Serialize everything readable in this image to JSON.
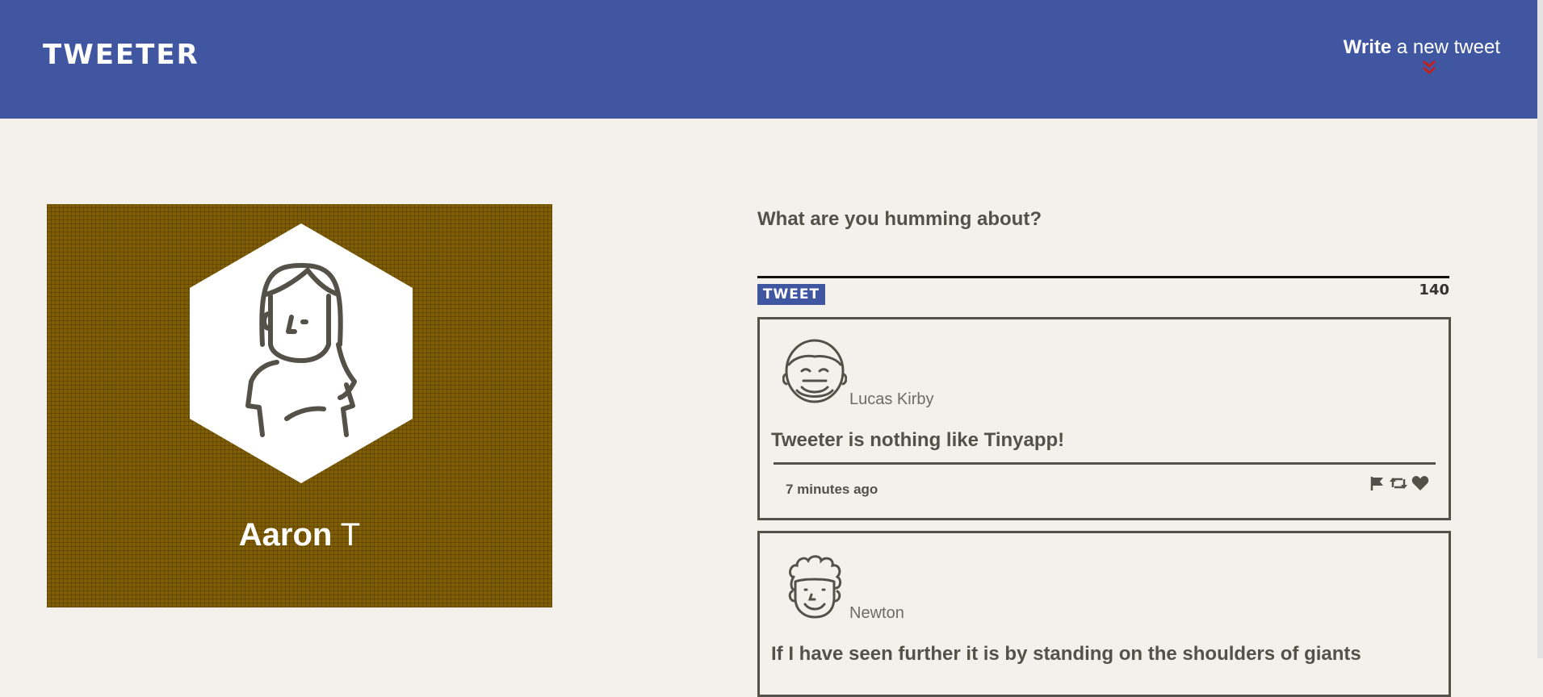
{
  "nav": {
    "brand": "TWEETER",
    "compose_bold": "Write",
    "compose_rest": " a new tweet"
  },
  "profile": {
    "first_name": "Aaron",
    "last_name": "T"
  },
  "composer": {
    "prompt": "What are you humming about?",
    "submit_label": "TWEET",
    "counter": "140"
  },
  "tweets": [
    {
      "handle": "Lucas Kirby",
      "content": "Tweeter is nothing like Tinyapp!",
      "time": "7 minutes ago",
      "actions": [
        "flag-icon",
        "retweet-icon",
        "heart-icon"
      ]
    },
    {
      "handle": "Newton",
      "content": "If I have seen further it is by standing on the shoulders of giants"
    }
  ],
  "colors": {
    "nav_bg": "#4056a1",
    "page_bg": "#f4f1ec",
    "profile_bg": "#7f5d05",
    "text": "#545149",
    "chevron": "#c0201c"
  }
}
